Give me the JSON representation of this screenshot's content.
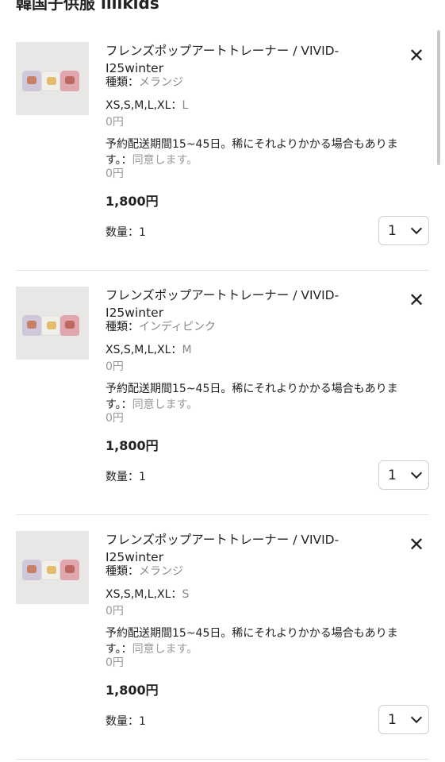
{
  "header": {
    "shop_name": "韓国子供服 ililkids"
  },
  "items": [
    {
      "name": "フレンズポップアートトレーナー / VIVID-I25winter",
      "type_label": "種類：",
      "type_value": "メランジ",
      "size_label": "XS,S,M,L,XL：",
      "size_value": "L",
      "option_price": "0円",
      "notice_text": "予約配送期間15~45日。稀にそれよりかかる場合もあります。：",
      "notice_agree": "同意します。",
      "notice_price": "0円",
      "price": "1,800円",
      "qty_label": "数量：1",
      "qty_value": "1"
    },
    {
      "name": "フレンズポップアートトレーナー / VIVID-I25winter",
      "type_label": "種類：",
      "type_value": "インディピンク",
      "size_label": "XS,S,M,L,XL：",
      "size_value": "M",
      "option_price": "0円",
      "notice_text": "予約配送期間15~45日。稀にそれよりかかる場合もあります。：",
      "notice_agree": "同意します。",
      "notice_price": "0円",
      "price": "1,800円",
      "qty_label": "数量：1",
      "qty_value": "1"
    },
    {
      "name": "フレンズポップアートトレーナー / VIVID-I25winter",
      "type_label": "種類：",
      "type_value": "メランジ",
      "size_label": "XS,S,M,L,XL：",
      "size_value": "S",
      "option_price": "0円",
      "notice_text": "予約配送期間15~45日。稀にそれよりかかる場合もあります。：",
      "notice_agree": "同意します。",
      "notice_price": "0円",
      "price": "1,800円",
      "qty_label": "数量：1",
      "qty_value": "1"
    }
  ],
  "icons": {
    "remove": "close-icon",
    "dropdown": "chevron-down-icon"
  }
}
